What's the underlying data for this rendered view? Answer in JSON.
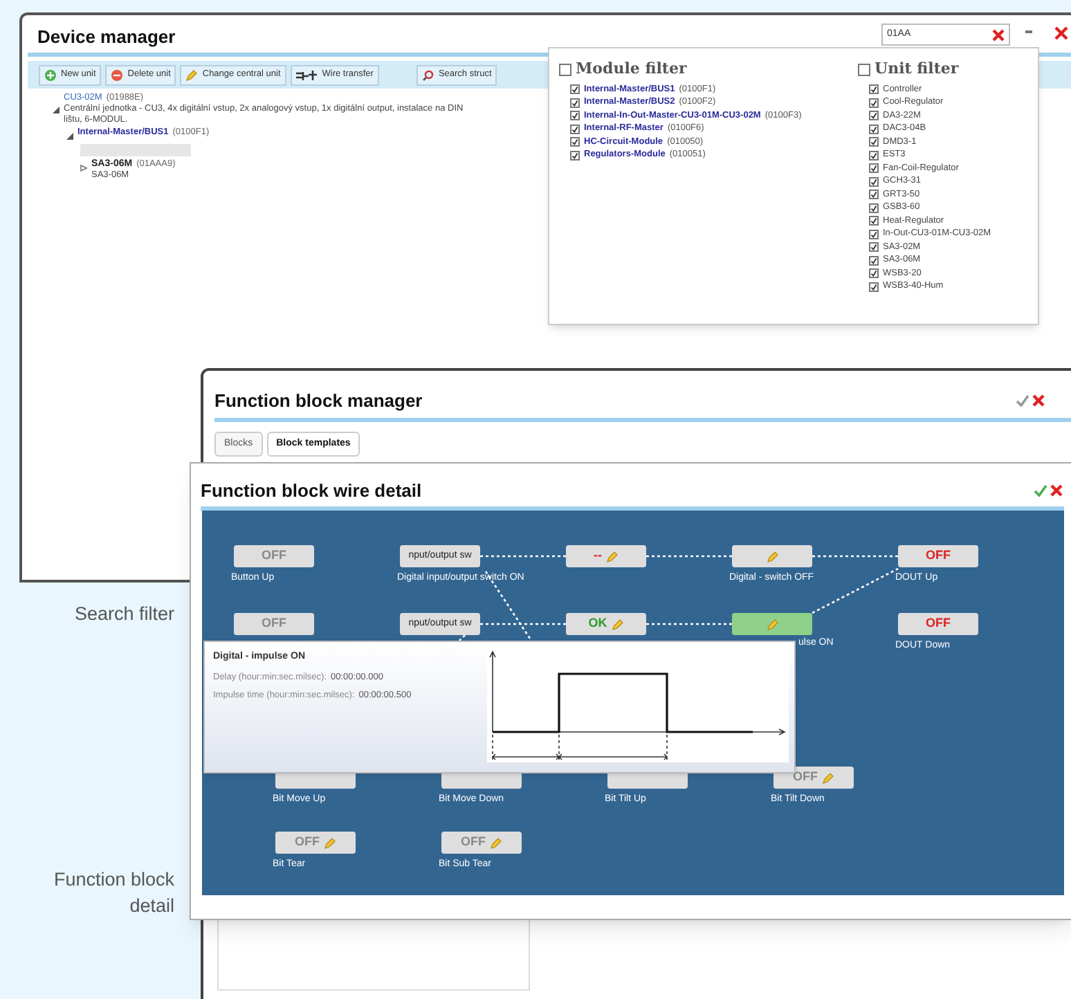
{
  "device_manager": {
    "title": "Device manager",
    "toolbar": [
      {
        "label": "New unit",
        "kind": "add"
      },
      {
        "label": "Delete unit",
        "kind": "delete"
      },
      {
        "label": "Change central unit",
        "kind": "change"
      },
      {
        "label": "Wire transfer",
        "kind": "wire"
      },
      {
        "label": "Search struct",
        "kind": "search"
      }
    ],
    "search": {
      "value": "01AA"
    },
    "tree": [
      {
        "name": "CU3-02M",
        "code": "(01988E)",
        "description": "Centrální jednotka - CU3, 4x digitální vstup, 2x analogový vstup, 1x digitální output, instalace na DIN lištu, 6-MODUL.",
        "expanded": true,
        "children": [
          {
            "name": "Internal-Master/BUS1",
            "code": "(0100F1)",
            "expanded": true,
            "children": [
              {
                "name": "SA3-06M",
                "code": "(01AAA9)",
                "description": "SA3-06M",
                "expanded": false
              }
            ]
          }
        ]
      }
    ]
  },
  "filter_popup": {
    "module_filter": {
      "label": "Module filter",
      "checked": false,
      "items": [
        {
          "name": "Internal-Master/BUS1",
          "code": "(0100F1)",
          "checked": true
        },
        {
          "name": "Internal-Master/BUS2",
          "code": "(0100F2)",
          "checked": true
        },
        {
          "name": "Internal-In-Out-Master-CU3-01M-CU3-02M",
          "code": "(0100F3)",
          "checked": true
        },
        {
          "name": "Internal-RF-Master",
          "code": "(0100F6)",
          "checked": true
        },
        {
          "name": "HC-Circuit-Module",
          "code": "(010050)",
          "checked": true
        },
        {
          "name": "Regulators-Module",
          "code": "(010051)",
          "checked": true
        }
      ]
    },
    "unit_filter": {
      "label": "Unit filter",
      "checked": false,
      "items": [
        {
          "name": "Controller",
          "checked": true
        },
        {
          "name": "Cool-Regulator",
          "checked": true
        },
        {
          "name": "DA3-22M",
          "checked": true
        },
        {
          "name": "DAC3-04B",
          "checked": true
        },
        {
          "name": "DMD3-1",
          "checked": true
        },
        {
          "name": "EST3",
          "checked": true
        },
        {
          "name": "Fan-Coil-Regulator",
          "checked": true
        },
        {
          "name": "GCH3-31",
          "checked": true
        },
        {
          "name": "GRT3-50",
          "checked": true
        },
        {
          "name": "GSB3-60",
          "checked": true
        },
        {
          "name": "Heat-Regulator",
          "checked": true
        },
        {
          "name": "In-Out-CU3-01M-CU3-02M",
          "checked": true
        },
        {
          "name": "SA3-02M",
          "checked": true
        },
        {
          "name": "SA3-06M",
          "checked": true
        },
        {
          "name": "WSB3-20",
          "checked": true
        },
        {
          "name": "WSB3-40-Hum",
          "checked": true
        }
      ]
    }
  },
  "function_block_manager": {
    "title": "Function block manager",
    "tabs": [
      {
        "label": "Blocks",
        "selected": false
      },
      {
        "label": "Block templates",
        "selected": true
      }
    ]
  },
  "wire_detail": {
    "title": "Function block wire detail",
    "rows": [
      [
        {
          "value": "OFF",
          "kind": "neutral",
          "editable": false,
          "highlighted": false,
          "label": "Button Up"
        },
        {
          "value": "nput/output sw",
          "kind": "text",
          "editable": false,
          "highlighted": false,
          "label": "Digital input/output switch ON"
        },
        {
          "value": "--",
          "kind": "red",
          "editable": true,
          "highlighted": false
        },
        {
          "kind": "neutral",
          "editable": true,
          "highlighted": false,
          "label": "Digital - switch OFF"
        },
        {
          "value": "OFF",
          "kind": "red",
          "editable": false,
          "highlighted": false,
          "label": "DOUT Up"
        }
      ],
      [
        {
          "value": "OFF",
          "kind": "neutral",
          "editable": false,
          "highlighted": false
        },
        {
          "value": "nput/output sw",
          "kind": "text",
          "editable": false,
          "highlighted": false
        },
        {
          "value": "OK",
          "kind": "green",
          "editable": true,
          "highlighted": false
        },
        {
          "kind": "neutral",
          "editable": true,
          "highlighted": true,
          "label": "ulse ON"
        },
        {
          "value": "OFF",
          "kind": "red",
          "editable": false,
          "highlighted": false,
          "label": "DOUT Down"
        }
      ],
      [
        {
          "kind": "neutral",
          "editable": false,
          "highlighted": false,
          "label": "Bit Move Up"
        },
        {
          "kind": "neutral",
          "editable": false,
          "highlighted": false,
          "label": "Bit Move Down"
        },
        {
          "kind": "neutral",
          "editable": false,
          "highlighted": false,
          "label": "Bit Tilt Up"
        },
        {
          "value": "OFF",
          "kind": "neutral",
          "editable": true,
          "highlighted": false,
          "label": "Bit Tilt Down"
        }
      ],
      [
        {
          "value": "OFF",
          "kind": "neutral",
          "editable": true,
          "highlighted": false,
          "label": "Bit Tear"
        },
        {
          "value": "OFF",
          "kind": "neutral",
          "editable": true,
          "highlighted": false,
          "label": "Bit Sub Tear"
        }
      ]
    ],
    "tooltip": {
      "title": "Digital - impulse ON",
      "lines": [
        {
          "label": "Delay (hour:min:sec.milsec):",
          "value": "00:00:00.000"
        },
        {
          "label": "Impulse time (hour:min:sec.milsec):",
          "value": "00:00:00.500"
        }
      ]
    }
  },
  "annotations": [
    "Search filter",
    "Function block detail"
  ]
}
